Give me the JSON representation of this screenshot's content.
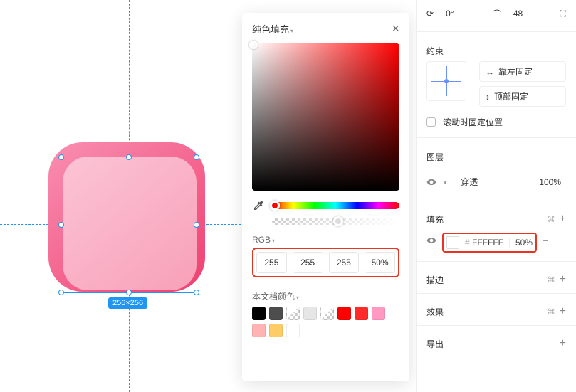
{
  "canvas": {
    "dimensions": "256×256"
  },
  "popover": {
    "title": "纯色填充",
    "mode": "RGB",
    "r": "255",
    "g": "255",
    "b": "255",
    "a": "50%",
    "docColorsLabel": "本文档颜色",
    "swatches": [
      "#000000",
      "#4d4d4d",
      "#ffffff",
      "#e6e6e6",
      "#ffffff",
      "#ff0000",
      "#ff2a2a",
      "#ff99c2",
      "#ffb3b3",
      "#ffcc66",
      "#ffffff"
    ],
    "checker": [
      2,
      4
    ]
  },
  "panel": {
    "rotation": "0°",
    "radius": "48",
    "constrain": {
      "label": "约束",
      "hLabel": "靠左固定",
      "vLabel": "顶部固定",
      "scrollLock": "滚动时固定位置"
    },
    "layer": {
      "label": "图层",
      "blend": "穿透",
      "opacity": "100%"
    },
    "fill": {
      "label": "填充",
      "hex": "FFFFFF",
      "opacity": "50%"
    },
    "stroke": {
      "label": "描边"
    },
    "effect": {
      "label": "效果"
    },
    "export": {
      "label": "导出"
    }
  }
}
